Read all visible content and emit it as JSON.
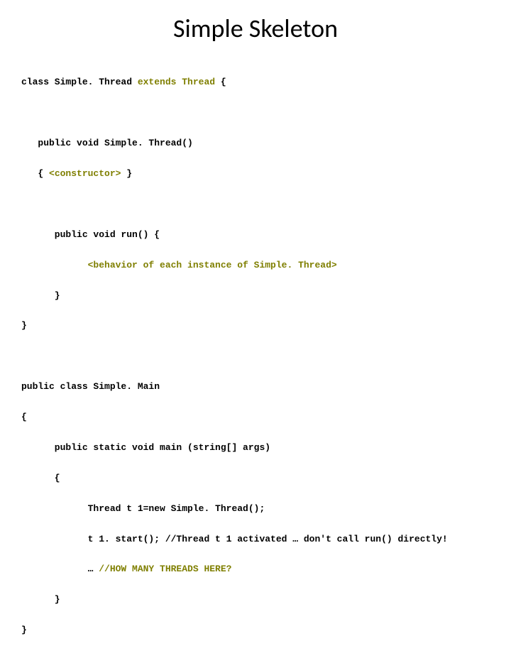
{
  "title": "Simple Skeleton",
  "line1a": "class Simple. Thread ",
  "line1b": "extends Thread",
  "line1c": " {",
  "line2": "   public void Simple. Thread()",
  "line3a": "   { ",
  "line3b": "<constructor>",
  "line3c": " }",
  "line4": "      public void run() {",
  "line5": "            <behavior of each instance of Simple. Thread>",
  "line6": "      }",
  "line7": "}",
  "line8": "public class Simple. Main",
  "line9": "{",
  "line10": "      public static void main (string[] args)",
  "line11": "      {",
  "line12": "            Thread t 1=new Simple. Thread();",
  "line13": "            t 1. start(); //Thread t 1 activated … don't call run() directly!",
  "line14a": "            … ",
  "line14b": "//HOW MANY THREADS HERE?",
  "line15": "      }",
  "line16": "}"
}
